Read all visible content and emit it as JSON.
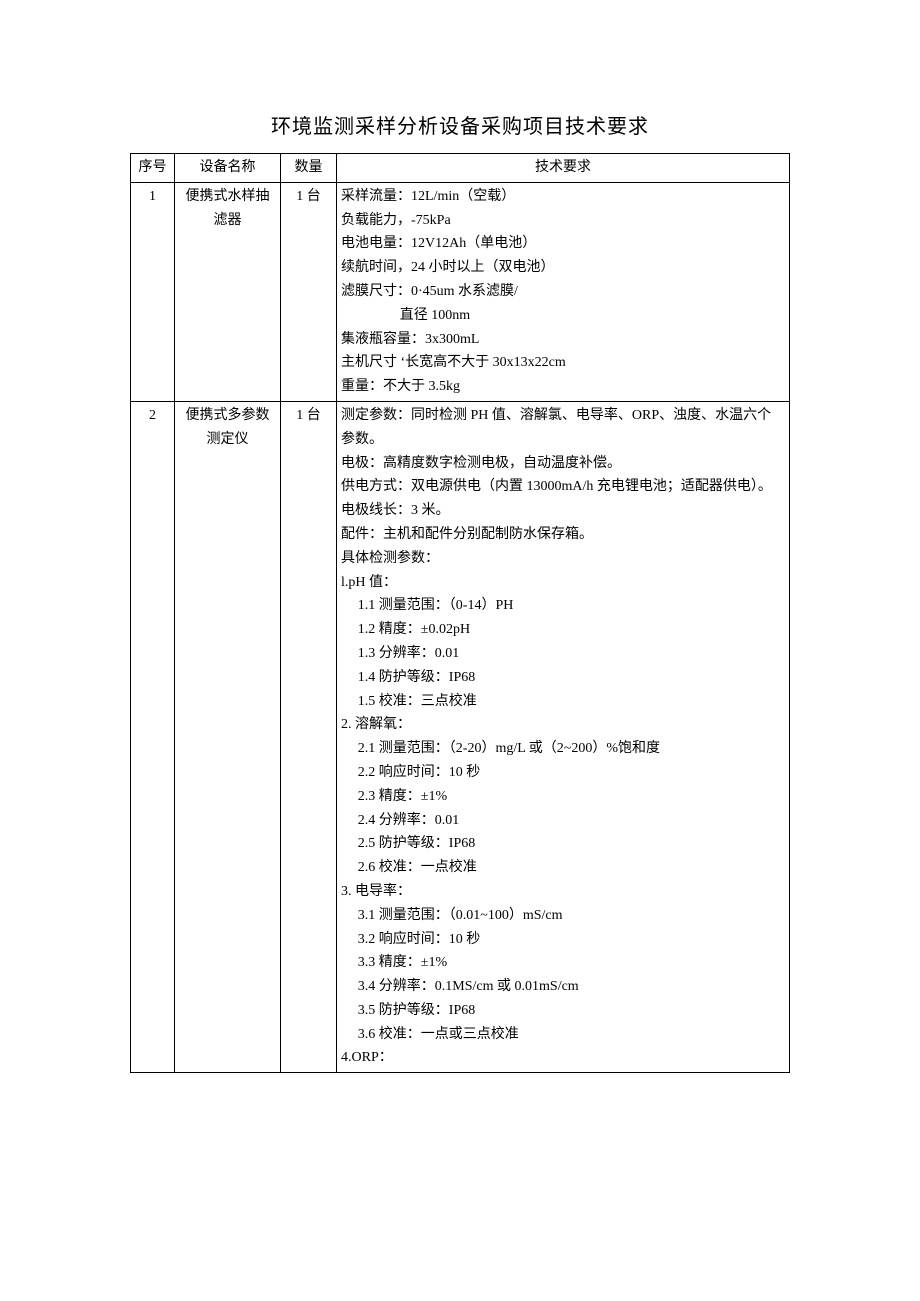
{
  "title": "环境监测采样分析设备采购项目技术要求",
  "headers": {
    "col1": "序号",
    "col2": "设备名称",
    "col3": "数量",
    "col4": "技术要求"
  },
  "rows": [
    {
      "no": "1",
      "name": "便携式水样抽滤器",
      "qty": "1 台",
      "spec_lines": [
        "采样流量：12L/min（空载）",
        "负载能力，-75kPa",
        "电池电量：12V12Ah（单电池）",
        "续航时间，24 小时以上（双电池）",
        "滤膜尺寸：0·45um 水系滤膜/"
      ],
      "spec_indent": "直径 100nm",
      "spec_lines2": [
        "集液瓶容量：3x300mL",
        "主机尺寸 ‘长宽高不大于 30x13x22cm",
        "重量：不大于 3.5kg"
      ]
    },
    {
      "no": "2",
      "name": "便携式多参数测定仪",
      "qty": "1 台",
      "spec_lines": [
        "测定参数：同时检测 PH 值、溶解氯、电导率、ORP、浊度、水温六个参数。",
        "电极：高精度数字检测电极，自动温度补偿。",
        "供电方式：双电源供电（内置 13000mA/h 充电锂电池；适配器供电）。",
        "电极线长：3 米。",
        "配件：主机和配件分别配制防水保存箱。",
        "具体检测参数：",
        "l.pH 值："
      ],
      "spec_sub_ph": [
        "1.1  测量范围：（0-14）PH",
        "1.2  精度：±0.02pH",
        "1.3  分辨率：0.01",
        "1.4  防护等级：IP68",
        "1.5  校准：三点校准"
      ],
      "spec_do_head": "2. 溶解氧：",
      "spec_sub_do": [
        "2.1 测量范围：（2-20）mg/L 或（2~200）%饱和度",
        "2.2 响应时间：10 秒",
        "2.3 精度：±1%",
        "2.4 分辨率：0.01",
        "2.5 防护等级：IP68",
        "2.6 校准：一点校准"
      ],
      "spec_ec_head": "3. 电导率：",
      "spec_sub_ec": [
        "3.1  测量范围：（0.01~100）mS/cm",
        "3.2  响应时间：10 秒",
        "3.3  精度：±1%",
        "3.4  分辨率：0.1MS/cm 或 0.01mS/cm",
        "3.5  防护等级：IP68",
        "3.6  校准：一点或三点校准"
      ],
      "spec_orp_head": "4.ORP："
    }
  ]
}
